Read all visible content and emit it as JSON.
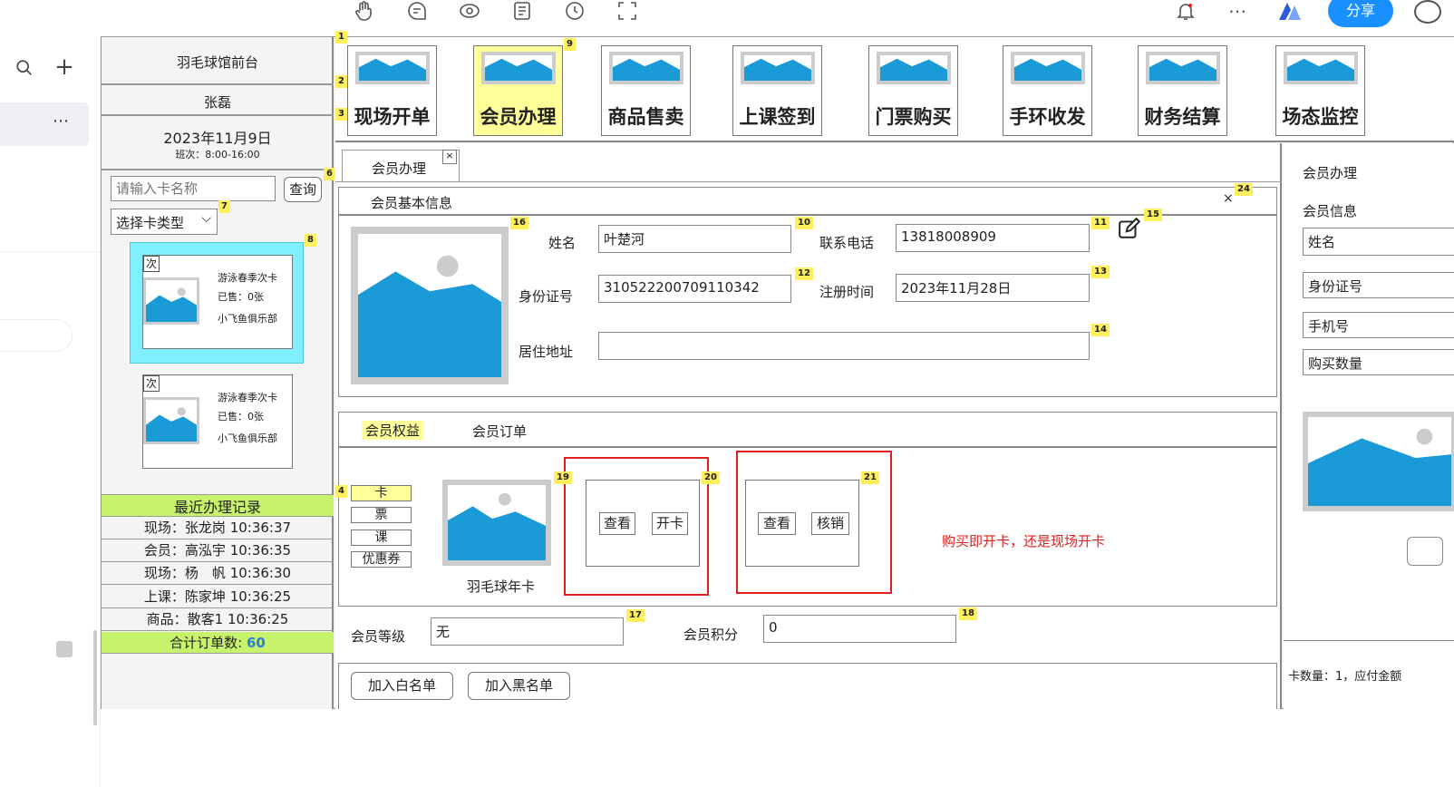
{
  "toolbar": {
    "icons": [
      "hand-icon",
      "comment-icon",
      "eye-icon",
      "note-icon",
      "clock-icon",
      "fullscreen-icon"
    ],
    "share_label": "分享"
  },
  "sidebar": {
    "venue": "羽毛球馆前台",
    "operator": "张磊",
    "date": "2023年11月9日",
    "shift": "班次：8:00-16:00",
    "search_placeholder": "请输入卡名称",
    "query_label": "查询",
    "card_type_label": "选择卡类型",
    "cards": [
      {
        "tag": "次",
        "name": "游泳春季次卡",
        "sold": "已售：0张",
        "club": "小飞鱼俱乐部"
      },
      {
        "tag": "次",
        "name": "游泳春季次卡",
        "sold": "已售：0张",
        "club": "小飞鱼俱乐部"
      }
    ],
    "records_title": "最近办理记录",
    "records": [
      "现场：张龙岗 10:36:37",
      "会员：高泓宇 10:36:35",
      "现场：杨　帆 10:36:30",
      "上课：陈家坤 10:36:25",
      "商品：散客1 10:36:25"
    ],
    "total_label": "合计订单数:",
    "total_value": "60"
  },
  "menu": [
    {
      "label": "现场开单",
      "active": false
    },
    {
      "label": "会员办理",
      "active": true
    },
    {
      "label": "商品售卖",
      "active": false
    },
    {
      "label": "上课签到",
      "active": false
    },
    {
      "label": "门票购买",
      "active": false
    },
    {
      "label": "手环收发",
      "active": false
    },
    {
      "label": "财务结算",
      "active": false
    },
    {
      "label": "场态监控",
      "active": false
    }
  ],
  "tab": {
    "label": "会员办理",
    "close": "×"
  },
  "basic": {
    "title": "会员基本信息",
    "close": "×",
    "name_label": "姓名",
    "name_value": "叶楚河",
    "phone_label": "联系电话",
    "phone_value": "13818008909",
    "id_label": "身份证号",
    "id_value": "310522200709110342",
    "reg_label": "注册时间",
    "reg_value": "2023年11月28日",
    "addr_label": "居住地址",
    "addr_value": ""
  },
  "benefits": {
    "tab_rights": "会员权益",
    "tab_orders": "会员订单",
    "side_items": [
      "卡",
      "票",
      "课",
      "优惠券"
    ],
    "card_name": "羽毛球年卡",
    "box1": {
      "view": "查看",
      "action": "开卡"
    },
    "box2": {
      "view": "查看",
      "action": "核销"
    },
    "note": "购买即开卡，还是现场开卡",
    "level_label": "会员等级",
    "level_value": "无",
    "points_label": "会员积分",
    "points_value": "0"
  },
  "actions": {
    "whitelist": "加入白名单",
    "blacklist": "加入黑名单"
  },
  "right": {
    "title": "会员办理",
    "info": "会员信息",
    "fields": [
      "姓名",
      "身份证号",
      "手机号",
      "购买数量"
    ],
    "footer": "卡数量：1，应付金额"
  },
  "badges": [
    "1",
    "2",
    "3",
    "4",
    "6",
    "7",
    "8",
    "9",
    "10",
    "11",
    "12",
    "13",
    "14",
    "15",
    "16",
    "17",
    "18",
    "19",
    "20",
    "21",
    "24"
  ],
  "colors": {
    "accent": "#1890ff",
    "highlight": "#ffff99",
    "cyan": "#80f0ff",
    "green": "#c6f26c",
    "red": "#e02020",
    "sky": "#1a9ad6"
  }
}
